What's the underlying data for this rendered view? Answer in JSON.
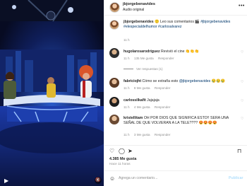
{
  "post": {
    "username": "jbjorgebenavides",
    "audio": "Audio original",
    "caption_emoji": "🙂",
    "caption_text": "Leo sus comentarios 🎬",
    "caption_tags": "#jbjorgebenavides #elespecialdelhumor #carlosalvarez",
    "caption_age": "11 h"
  },
  "comments": [
    {
      "username": "hugolarosarodriguez",
      "text": "Revivió el cine 👏👏👏",
      "age": "11 h",
      "likes": "135 Me gusta",
      "reply": "Responder",
      "view_replies": "Ver respuestas (1)"
    },
    {
      "username": "fabriciojht",
      "text": "Cómo se extraña esto",
      "mention": "@jbjorgebenavides",
      "suffix": "😢😢😢",
      "age": "11 h",
      "likes": "8 Me gusta",
      "reply": "Responder"
    },
    {
      "username": "carlossilkafit",
      "text": "Jajajaja",
      "age": "11 h",
      "likes": "4 Me gusta",
      "reply": "Responder"
    },
    {
      "username": "kristellitam",
      "text": "OH POR DIOS QUE SIGNIFICA ESTO!! SERA UNA SEÑAL DE QUE VOLVERAN A LA TELE???? 😍😍😍😍",
      "age": "11 h",
      "likes": "3 Me gusta",
      "reply": "Responder"
    }
  ],
  "footer": {
    "likes": "4.385 Me gusta",
    "ago": "Hace 11 horas",
    "comment_placeholder": "Agrega un comentario...",
    "publish": "Publicar"
  },
  "icons": {
    "more": "more-options-icon",
    "heart": "heart-icon",
    "comment": "comment-icon",
    "share": "share-icon",
    "save": "bookmark-icon",
    "emoji": "emoji-icon",
    "reels": "reels-icon",
    "mute": "audio-muted-icon"
  },
  "colors": {
    "link": "#00376b",
    "muted": "#8e8e8e",
    "publish_disabled": "#b2dffc"
  }
}
